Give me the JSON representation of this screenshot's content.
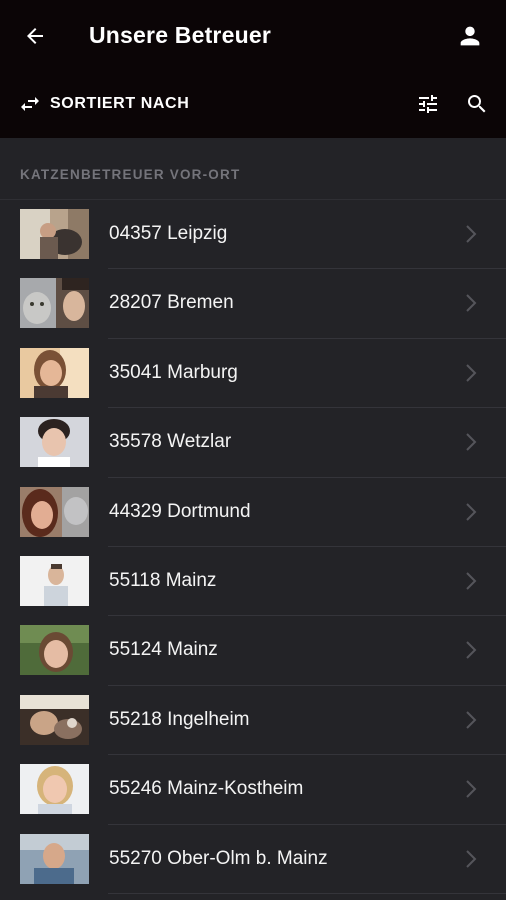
{
  "header": {
    "title": "Unsere Betreuer",
    "back_icon": "arrow-left-icon",
    "account_icon": "person-icon"
  },
  "toolbar": {
    "sort_label": "SORTIERT NACH",
    "sort_icon": "swap-horizontal-icon",
    "filter_icon": "tune-sliders-icon",
    "search_icon": "search-icon"
  },
  "section": {
    "label": "KATZENBETREUER VOR-ORT"
  },
  "colors": {
    "appbar_bg": "#0b0506",
    "page_bg": "#232327",
    "section_text": "#74747b",
    "chevron": "#55555b"
  },
  "sitters": [
    {
      "label": "04357 Leipzig"
    },
    {
      "label": "28207 Bremen"
    },
    {
      "label": "35041 Marburg"
    },
    {
      "label": "35578 Wetzlar"
    },
    {
      "label": "44329 Dortmund"
    },
    {
      "label": "55118 Mainz"
    },
    {
      "label": "55124 Mainz"
    },
    {
      "label": "55218 Ingelheim"
    },
    {
      "label": "55246 Mainz-Kostheim"
    },
    {
      "label": "55270 Ober-Olm b. Mainz"
    }
  ]
}
